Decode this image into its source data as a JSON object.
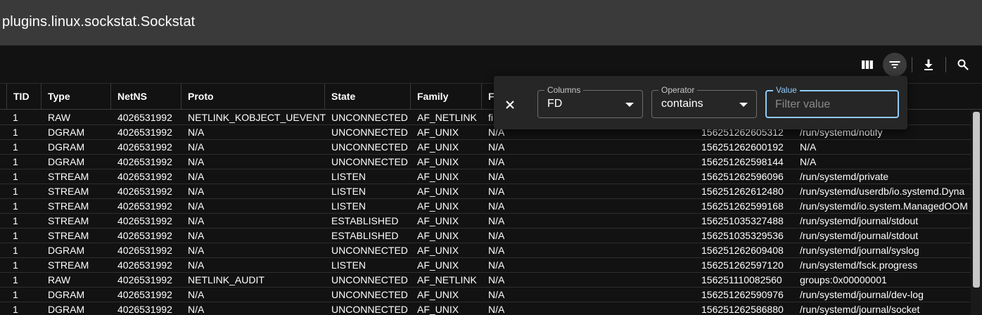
{
  "title": "plugins.linux.sockstat.Sockstat",
  "toolbar": {
    "icons": [
      "columns-icon",
      "filter-icon",
      "download-icon",
      "search-icon"
    ]
  },
  "columns": [
    "TID",
    "Type",
    "NetNS",
    "Proto",
    "State",
    "Family",
    "F"
  ],
  "filter_panel": {
    "columns_label": "Columns",
    "columns_value": "FD",
    "operator_label": "Operator",
    "operator_value": "contains",
    "value_label": "Value",
    "value_placeholder": "Filter value",
    "value_current": ""
  },
  "rows": [
    {
      "tid": "1",
      "type": "RAW",
      "netns": "4026531992",
      "proto": "NETLINK_KOBJECT_UEVENT",
      "state": "UNCONNECTED",
      "family": "AF_NETLINK",
      "f": "fi",
      "g": "",
      "addr": "",
      "path": ""
    },
    {
      "tid": "1",
      "type": "DGRAM",
      "netns": "4026531992",
      "proto": "N/A",
      "state": "UNCONNECTED",
      "family": "AF_UNIX",
      "f": "N/A",
      "g": "",
      "addr": "156251262605312",
      "path": "/run/systemd/notify"
    },
    {
      "tid": "1",
      "type": "DGRAM",
      "netns": "4026531992",
      "proto": "N/A",
      "state": "UNCONNECTED",
      "family": "AF_UNIX",
      "f": "N/A",
      "g": "",
      "addr": "156251262600192",
      "path": "N/A"
    },
    {
      "tid": "1",
      "type": "DGRAM",
      "netns": "4026531992",
      "proto": "N/A",
      "state": "UNCONNECTED",
      "family": "AF_UNIX",
      "f": "N/A",
      "g": "",
      "addr": "156251262598144",
      "path": "N/A"
    },
    {
      "tid": "1",
      "type": "STREAM",
      "netns": "4026531992",
      "proto": "N/A",
      "state": "LISTEN",
      "family": "AF_UNIX",
      "f": "N/A",
      "g": "",
      "addr": "156251262596096",
      "path": "/run/systemd/private"
    },
    {
      "tid": "1",
      "type": "STREAM",
      "netns": "4026531992",
      "proto": "N/A",
      "state": "LISTEN",
      "family": "AF_UNIX",
      "f": "N/A",
      "g": "",
      "addr": "156251262612480",
      "path": "/run/systemd/userdb/io.systemd.Dyna"
    },
    {
      "tid": "1",
      "type": "STREAM",
      "netns": "4026531992",
      "proto": "N/A",
      "state": "LISTEN",
      "family": "AF_UNIX",
      "f": "N/A",
      "g": "",
      "addr": "156251262599168",
      "path": "/run/systemd/io.system.ManagedOOM"
    },
    {
      "tid": "1",
      "type": "STREAM",
      "netns": "4026531992",
      "proto": "N/A",
      "state": "ESTABLISHED",
      "family": "AF_UNIX",
      "f": "N/A",
      "g": "",
      "addr": "156251035327488",
      "path": "/run/systemd/journal/stdout"
    },
    {
      "tid": "1",
      "type": "STREAM",
      "netns": "4026531992",
      "proto": "N/A",
      "state": "ESTABLISHED",
      "family": "AF_UNIX",
      "f": "N/A",
      "g": "",
      "addr": "156251035329536",
      "path": "/run/systemd/journal/stdout"
    },
    {
      "tid": "1",
      "type": "DGRAM",
      "netns": "4026531992",
      "proto": "N/A",
      "state": "UNCONNECTED",
      "family": "AF_UNIX",
      "f": "N/A",
      "g": "",
      "addr": "156251262609408",
      "path": "/run/systemd/journal/syslog"
    },
    {
      "tid": "1",
      "type": "STREAM",
      "netns": "4026531992",
      "proto": "N/A",
      "state": "LISTEN",
      "family": "AF_UNIX",
      "f": "N/A",
      "g": "",
      "addr": "156251262597120",
      "path": "/run/systemd/fsck.progress"
    },
    {
      "tid": "1",
      "type": "RAW",
      "netns": "4026531992",
      "proto": "NETLINK_AUDIT",
      "state": "UNCONNECTED",
      "family": "AF_NETLINK",
      "f": "N/A",
      "g": "",
      "addr": "156251110082560",
      "path": "groups:0x00000001"
    },
    {
      "tid": "1",
      "type": "DGRAM",
      "netns": "4026531992",
      "proto": "N/A",
      "state": "UNCONNECTED",
      "family": "AF_UNIX",
      "f": "N/A",
      "g": "",
      "addr": "156251262590976",
      "path": "/run/systemd/journal/dev-log"
    },
    {
      "tid": "1",
      "type": "DGRAM",
      "netns": "4026531992",
      "proto": "N/A",
      "state": "UNCONNECTED",
      "family": "AF_UNIX",
      "f": "N/A",
      "g": "",
      "addr": "156251262586880",
      "path": "/run/systemd/journal/socket"
    }
  ]
}
